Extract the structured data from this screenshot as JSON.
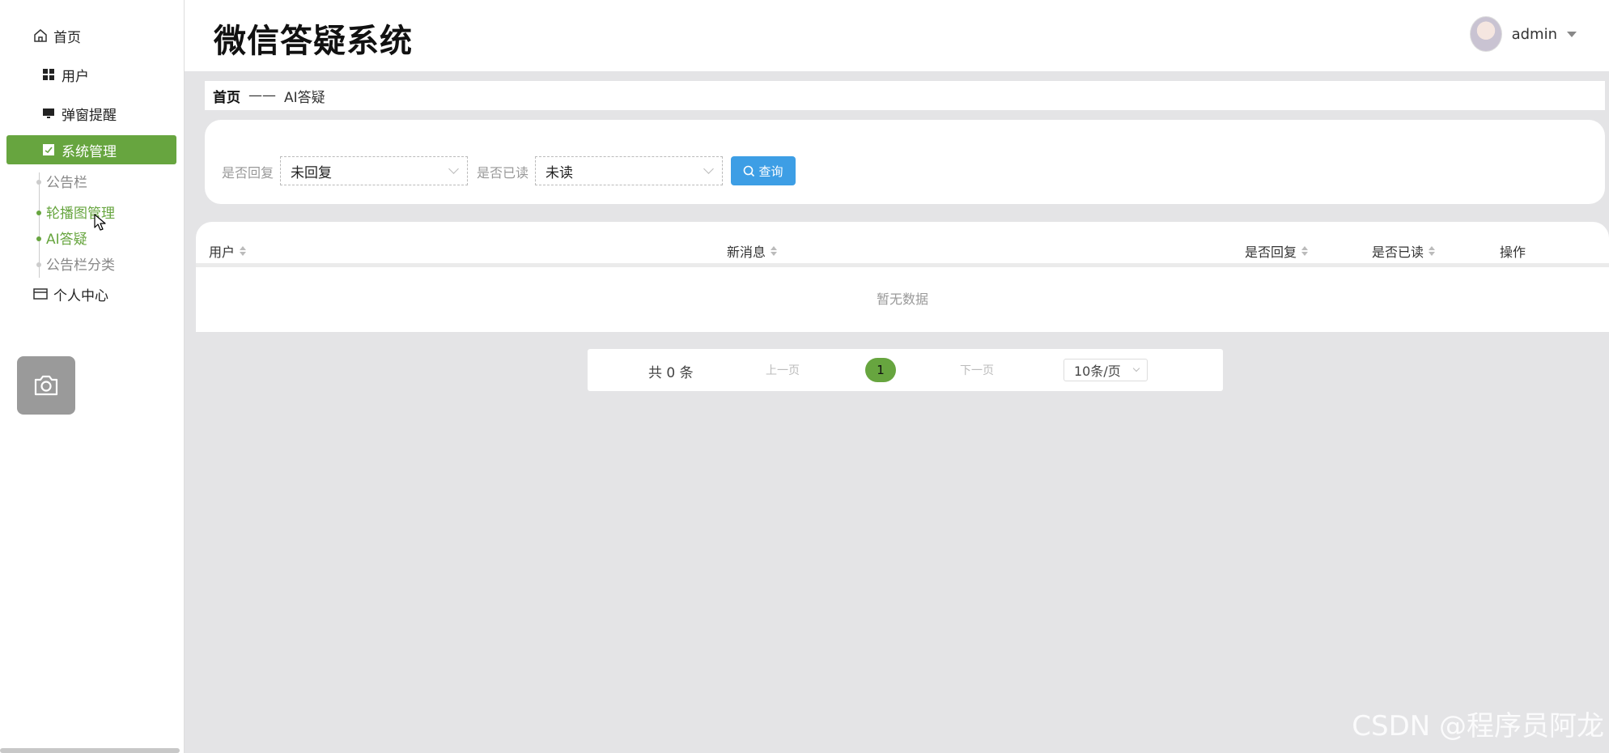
{
  "app": {
    "title": "微信答疑系统"
  },
  "user": {
    "name": "admin"
  },
  "sidebar": {
    "items": [
      {
        "label": "首页",
        "icon": "home-icon"
      },
      {
        "label": "用户",
        "icon": "grid-icon"
      },
      {
        "label": "弹窗提醒",
        "icon": "monitor-icon"
      },
      {
        "label": "系统管理",
        "icon": "check-square-icon",
        "active": true
      },
      {
        "label": "个人中心",
        "icon": "card-icon"
      }
    ],
    "submenu": [
      {
        "label": "公告栏"
      },
      {
        "label": "轮播图管理",
        "highlight": true
      },
      {
        "label": "AI答疑",
        "highlight": true
      },
      {
        "label": "公告栏分类"
      }
    ]
  },
  "breadcrumb": {
    "home": "首页",
    "separator": "——",
    "current": "AI答疑"
  },
  "filters": {
    "reply_label": "是否回复",
    "reply_value": "未回复",
    "read_label": "是否已读",
    "read_value": "未读",
    "query_label": "查询"
  },
  "table": {
    "columns": [
      "用户",
      "新消息",
      "是否回复",
      "是否已读",
      "操作"
    ],
    "empty_text": "暂无数据"
  },
  "pagination": {
    "total": "共 0 条",
    "prev": "上一页",
    "current_page": "1",
    "next": "下一页",
    "page_size": "10条/页"
  },
  "watermark": "CSDN @程序员阿龙",
  "colors": {
    "accent": "#67a53f",
    "query_button": "#3d9ee5"
  }
}
